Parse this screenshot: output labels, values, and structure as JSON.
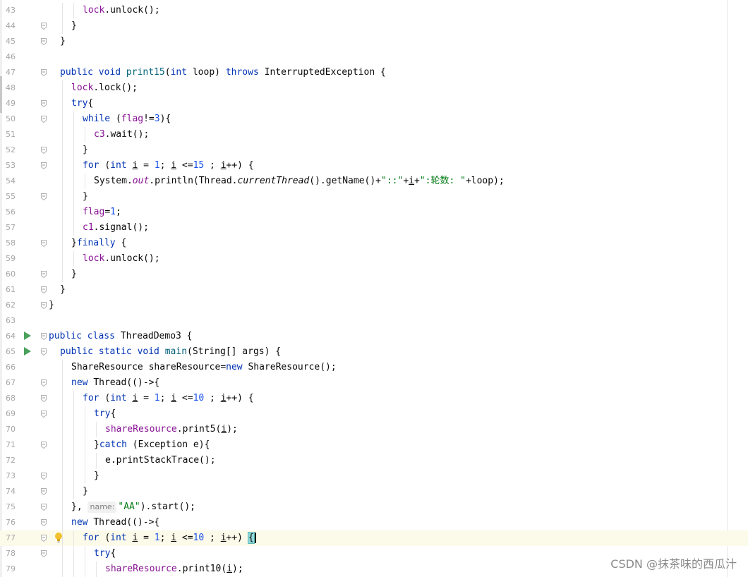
{
  "editor": {
    "lines": [
      {
        "n": "43",
        "indent": 3,
        "tokens": [
          {
            "t": "lock",
            "c": "fld"
          },
          {
            "t": ".unlock();"
          }
        ]
      },
      {
        "n": "44",
        "indent": 2,
        "tokens": [
          {
            "t": "}"
          }
        ]
      },
      {
        "n": "45",
        "indent": 1,
        "tokens": [
          {
            "t": "}"
          }
        ]
      },
      {
        "n": "46",
        "indent": 0,
        "tokens": []
      },
      {
        "n": "47",
        "indent": 1,
        "tokens": [
          {
            "t": "public void ",
            "c": "kw"
          },
          {
            "t": "print15",
            "c": "fn"
          },
          {
            "t": "("
          },
          {
            "t": "int ",
            "c": "kw"
          },
          {
            "t": "loop) "
          },
          {
            "t": "throws ",
            "c": "kw"
          },
          {
            "t": "InterruptedException {"
          }
        ]
      },
      {
        "n": "48",
        "indent": 2,
        "tokens": [
          {
            "t": "lock",
            "c": "fld"
          },
          {
            "t": ".lock();"
          }
        ]
      },
      {
        "n": "49",
        "indent": 2,
        "tokens": [
          {
            "t": "try",
            "c": "kw"
          },
          {
            "t": "{"
          }
        ]
      },
      {
        "n": "50",
        "indent": 3,
        "tokens": [
          {
            "t": "while ",
            "c": "kw"
          },
          {
            "t": "("
          },
          {
            "t": "flag",
            "c": "fld"
          },
          {
            "t": "!="
          },
          {
            "t": "3",
            "c": "num"
          },
          {
            "t": "){"
          }
        ]
      },
      {
        "n": "51",
        "indent": 4,
        "tokens": [
          {
            "t": "c3",
            "c": "fld"
          },
          {
            "t": ".wait();"
          }
        ]
      },
      {
        "n": "52",
        "indent": 3,
        "tokens": [
          {
            "t": "}"
          }
        ]
      },
      {
        "n": "53",
        "indent": 3,
        "tokens": [
          {
            "t": "for ",
            "c": "kw"
          },
          {
            "t": "("
          },
          {
            "t": "int ",
            "c": "kw"
          },
          {
            "t": "i",
            "c": "ul"
          },
          {
            "t": " = "
          },
          {
            "t": "1",
            "c": "num"
          },
          {
            "t": "; "
          },
          {
            "t": "i",
            "c": "ul"
          },
          {
            "t": " <="
          },
          {
            "t": "15",
            "c": "num"
          },
          {
            "t": " ; "
          },
          {
            "t": "i",
            "c": "ul"
          },
          {
            "t": "++) {"
          }
        ]
      },
      {
        "n": "54",
        "indent": 4,
        "tokens": [
          {
            "t": "System."
          },
          {
            "t": "out",
            "c": "fld it"
          },
          {
            "t": ".println(Thread."
          },
          {
            "t": "currentThread",
            "c": "it"
          },
          {
            "t": "().getName()+"
          },
          {
            "t": "\"::\"",
            "c": "str"
          },
          {
            "t": "+"
          },
          {
            "t": "i",
            "c": "ul"
          },
          {
            "t": "+"
          },
          {
            "t": "\":轮数: \"",
            "c": "str"
          },
          {
            "t": "+loop);"
          }
        ]
      },
      {
        "n": "55",
        "indent": 3,
        "tokens": [
          {
            "t": "}"
          }
        ]
      },
      {
        "n": "56",
        "indent": 3,
        "tokens": [
          {
            "t": "flag",
            "c": "fld"
          },
          {
            "t": "="
          },
          {
            "t": "1",
            "c": "num"
          },
          {
            "t": ";"
          }
        ]
      },
      {
        "n": "57",
        "indent": 3,
        "tokens": [
          {
            "t": "c1",
            "c": "fld"
          },
          {
            "t": ".signal();"
          }
        ]
      },
      {
        "n": "58",
        "indent": 2,
        "tokens": [
          {
            "t": "}"
          },
          {
            "t": "finally ",
            "c": "kw"
          },
          {
            "t": "{"
          }
        ]
      },
      {
        "n": "59",
        "indent": 3,
        "tokens": [
          {
            "t": "lock",
            "c": "fld"
          },
          {
            "t": ".unlock();"
          }
        ]
      },
      {
        "n": "60",
        "indent": 2,
        "tokens": [
          {
            "t": "}"
          }
        ]
      },
      {
        "n": "61",
        "indent": 1,
        "tokens": [
          {
            "t": "}"
          }
        ]
      },
      {
        "n": "62",
        "indent": 0,
        "tokens": [
          {
            "t": "}"
          }
        ]
      },
      {
        "n": "63",
        "indent": 0,
        "tokens": []
      },
      {
        "n": "64",
        "indent": 0,
        "run": true,
        "tokens": [
          {
            "t": "public class ",
            "c": "kw"
          },
          {
            "t": "ThreadDemo3 {"
          }
        ]
      },
      {
        "n": "65",
        "indent": 1,
        "run": true,
        "tokens": [
          {
            "t": "public static void ",
            "c": "kw"
          },
          {
            "t": "main",
            "c": "fn"
          },
          {
            "t": "(String[] args) {"
          }
        ]
      },
      {
        "n": "66",
        "indent": 2,
        "tokens": [
          {
            "t": "ShareResource shareResource="
          },
          {
            "t": "new ",
            "c": "kw"
          },
          {
            "t": "ShareResource();"
          }
        ]
      },
      {
        "n": "67",
        "indent": 2,
        "tokens": [
          {
            "t": "new ",
            "c": "kw"
          },
          {
            "t": "Thread(()->{"
          }
        ]
      },
      {
        "n": "68",
        "indent": 3,
        "tokens": [
          {
            "t": "for ",
            "c": "kw"
          },
          {
            "t": "("
          },
          {
            "t": "int ",
            "c": "kw"
          },
          {
            "t": "i",
            "c": "ul"
          },
          {
            "t": " = "
          },
          {
            "t": "1",
            "c": "num"
          },
          {
            "t": "; "
          },
          {
            "t": "i",
            "c": "ul"
          },
          {
            "t": " <="
          },
          {
            "t": "10",
            "c": "num"
          },
          {
            "t": " ; "
          },
          {
            "t": "i",
            "c": "ul"
          },
          {
            "t": "++) {"
          }
        ]
      },
      {
        "n": "69",
        "indent": 4,
        "tokens": [
          {
            "t": "try",
            "c": "kw"
          },
          {
            "t": "{"
          }
        ]
      },
      {
        "n": "70",
        "indent": 5,
        "tokens": [
          {
            "t": "shareResource",
            "c": "fld"
          },
          {
            "t": ".print5("
          },
          {
            "t": "i",
            "c": "ul"
          },
          {
            "t": ");"
          }
        ]
      },
      {
        "n": "71",
        "indent": 4,
        "tokens": [
          {
            "t": "}"
          },
          {
            "t": "catch ",
            "c": "kw"
          },
          {
            "t": "(Exception e){"
          }
        ]
      },
      {
        "n": "72",
        "indent": 5,
        "tokens": [
          {
            "t": "e.printStackTrace();"
          }
        ]
      },
      {
        "n": "73",
        "indent": 4,
        "tokens": [
          {
            "t": "}"
          }
        ]
      },
      {
        "n": "74",
        "indent": 3,
        "tokens": [
          {
            "t": "}"
          }
        ]
      },
      {
        "n": "75",
        "indent": 2,
        "tokens": [
          {
            "t": "}, "
          },
          {
            "t": "name:",
            "c": "hint"
          },
          {
            "t": "\"AA\"",
            "c": "str"
          },
          {
            "t": ").start();"
          }
        ]
      },
      {
        "n": "76",
        "indent": 2,
        "tokens": [
          {
            "t": "new ",
            "c": "kw"
          },
          {
            "t": "Thread(()->{"
          }
        ]
      },
      {
        "n": "77",
        "indent": 3,
        "current": true,
        "bulb": true,
        "tokens": [
          {
            "t": "for ",
            "c": "kw"
          },
          {
            "t": "("
          },
          {
            "t": "int ",
            "c": "kw"
          },
          {
            "t": "i",
            "c": "ul"
          },
          {
            "t": " = "
          },
          {
            "t": "1",
            "c": "num"
          },
          {
            "t": "; "
          },
          {
            "t": "i",
            "c": "ul"
          },
          {
            "t": " <="
          },
          {
            "t": "10",
            "c": "num"
          },
          {
            "t": " ; "
          },
          {
            "t": "i",
            "c": "ul"
          },
          {
            "t": "++) "
          },
          {
            "t": "{",
            "c": "brace-hl"
          }
        ],
        "caret": true
      },
      {
        "n": "78",
        "indent": 4,
        "tokens": [
          {
            "t": "try",
            "c": "kw"
          },
          {
            "t": "{"
          }
        ]
      },
      {
        "n": "79",
        "indent": 5,
        "tokens": [
          {
            "t": "shareResource",
            "c": "fld"
          },
          {
            "t": ".print10("
          },
          {
            "t": "i",
            "c": "ul"
          },
          {
            "t": ");"
          }
        ]
      }
    ]
  },
  "icons": {
    "run": "run-gutter-icon",
    "intention": "lightbulb-icon",
    "fold": "fold-marker-icon"
  },
  "colors": {
    "keyword": "#0033b3",
    "field": "#871094",
    "number": "#1750eb",
    "string": "#067d17",
    "method": "#00627a",
    "current_line": "#fcfae9",
    "run_icon": "#49a15c"
  },
  "watermark": "CSDN @抹茶味的西瓜汁"
}
